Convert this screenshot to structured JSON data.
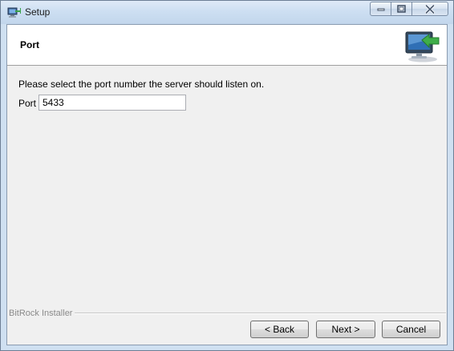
{
  "window": {
    "title": "Setup",
    "icons": {
      "app": "setup-icon",
      "minimize": "minimize-icon",
      "maximize": "maximize-icon",
      "close": "close-icon"
    }
  },
  "header": {
    "title": "Port",
    "logo_icon": "computer-arrow-icon"
  },
  "body": {
    "instruction": "Please select the port number the server should listen on.",
    "port_label": "Port",
    "port_value": "5433"
  },
  "footer": {
    "brand": "BitRock Installer",
    "back_label": "< Back",
    "next_label": "Next >",
    "cancel_label": "Cancel"
  },
  "colors": {
    "frame": "#cfe0f1",
    "content_bg": "#f0f0f0",
    "header_bg": "#ffffff",
    "close_glyph": "#4a5a70"
  }
}
